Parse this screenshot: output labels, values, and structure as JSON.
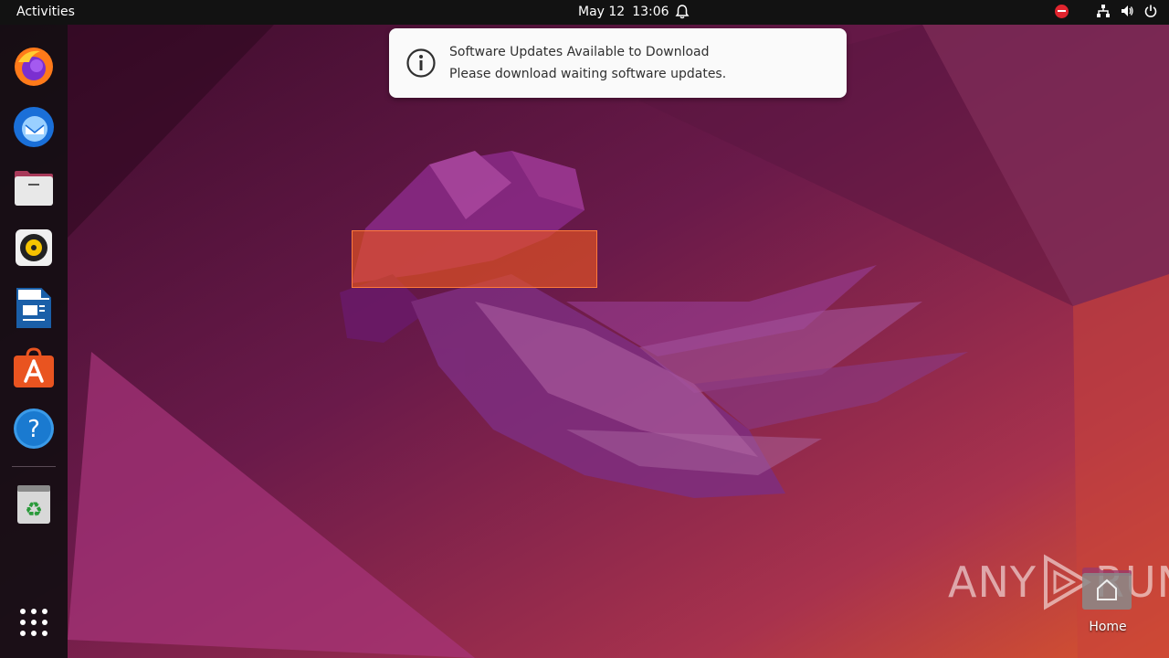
{
  "topbar": {
    "activities_label": "Activities",
    "date": "May 12",
    "time": "13:06"
  },
  "notification": {
    "title": "Software Updates Available to Download",
    "body": "Please download waiting software updates."
  },
  "dock": {
    "items": [
      {
        "name": "Firefox",
        "icon": "firefox-icon"
      },
      {
        "name": "Thunderbird",
        "icon": "thunderbird-icon"
      },
      {
        "name": "Files",
        "icon": "files-icon"
      },
      {
        "name": "Rhythmbox",
        "icon": "rhythmbox-icon"
      },
      {
        "name": "LibreOffice Writer",
        "icon": "libreoffice-writer-icon"
      },
      {
        "name": "Ubuntu Software",
        "icon": "ubuntu-software-icon"
      },
      {
        "name": "Help",
        "icon": "help-icon"
      },
      {
        "name": "Trash",
        "icon": "trash-icon"
      },
      {
        "name": "Show Applications",
        "icon": "app-grid-icon"
      }
    ]
  },
  "desktop": {
    "home_label": "Home"
  },
  "watermark": {
    "left": "ANY",
    "right": "RUN"
  },
  "colors": {
    "accent": "#e95420",
    "topbar": "#121212",
    "notification_bg": "#fafafa"
  }
}
